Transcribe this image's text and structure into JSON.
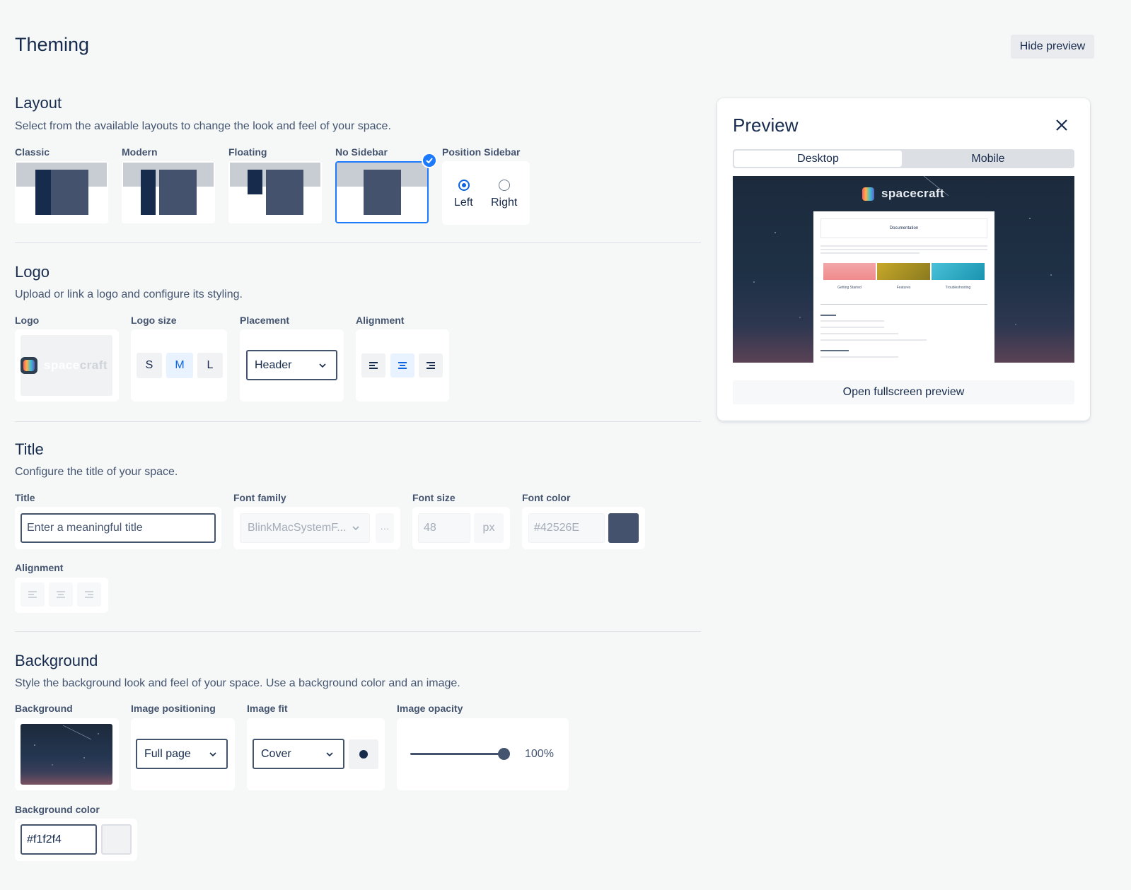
{
  "page": {
    "title": "Theming",
    "hide_preview_label": "Hide preview"
  },
  "layout": {
    "title": "Layout",
    "description": "Select from the available layouts to change the look and feel of your space.",
    "options": [
      {
        "label": "Classic"
      },
      {
        "label": "Modern"
      },
      {
        "label": "Floating"
      },
      {
        "label": "No Sidebar",
        "selected": true
      }
    ],
    "position_sidebar": {
      "label": "Position Sidebar",
      "left": "Left",
      "right": "Right",
      "selected": "Left"
    }
  },
  "logo": {
    "title": "Logo",
    "description": "Upload or link a logo and configure its styling.",
    "logo_label": "Logo",
    "logo_text_part1": "space",
    "logo_text_part2": "craft",
    "size_label": "Logo size",
    "sizes": [
      "S",
      "M",
      "L"
    ],
    "size_selected": "M",
    "placement_label": "Placement",
    "placement_value": "Header",
    "alignment_label": "Alignment",
    "alignment_selected": "center"
  },
  "title_section": {
    "title": "Title",
    "description": "Configure the title of your space.",
    "title_label": "Title",
    "title_placeholder": "Enter a meaningful title",
    "font_family_label": "Font family",
    "font_family_value": "BlinkMacSystemF...",
    "more_label": "···",
    "font_size_label": "Font size",
    "font_size_value": "48",
    "font_size_unit": "px",
    "font_color_label": "Font color",
    "font_color_value": "#42526E",
    "alignment_label": "Alignment"
  },
  "background": {
    "title": "Background",
    "description": "Style the background look and feel of your space. Use a background color and an image.",
    "bg_label": "Background",
    "positioning_label": "Image positioning",
    "positioning_value": "Full page",
    "fit_label": "Image fit",
    "fit_value": "Cover",
    "opacity_label": "Image opacity",
    "opacity_value": "100%",
    "opacity_fraction": 1.0,
    "color_label": "Background color",
    "color_value": "#f1f2f4"
  },
  "preview": {
    "title": "Preview",
    "tabs": [
      "Desktop",
      "Mobile"
    ],
    "active_tab": "Desktop",
    "brand": "spacecraft",
    "doc_title": "Documentation",
    "cards": [
      "Getting Started",
      "Features",
      "Troubleshooting"
    ],
    "fullscreen_label": "Open fullscreen preview"
  },
  "colors": {
    "accent": "#1d7afc",
    "navy": "#172b4d",
    "slate": "#44526e",
    "bg": "#f6f8f8"
  }
}
